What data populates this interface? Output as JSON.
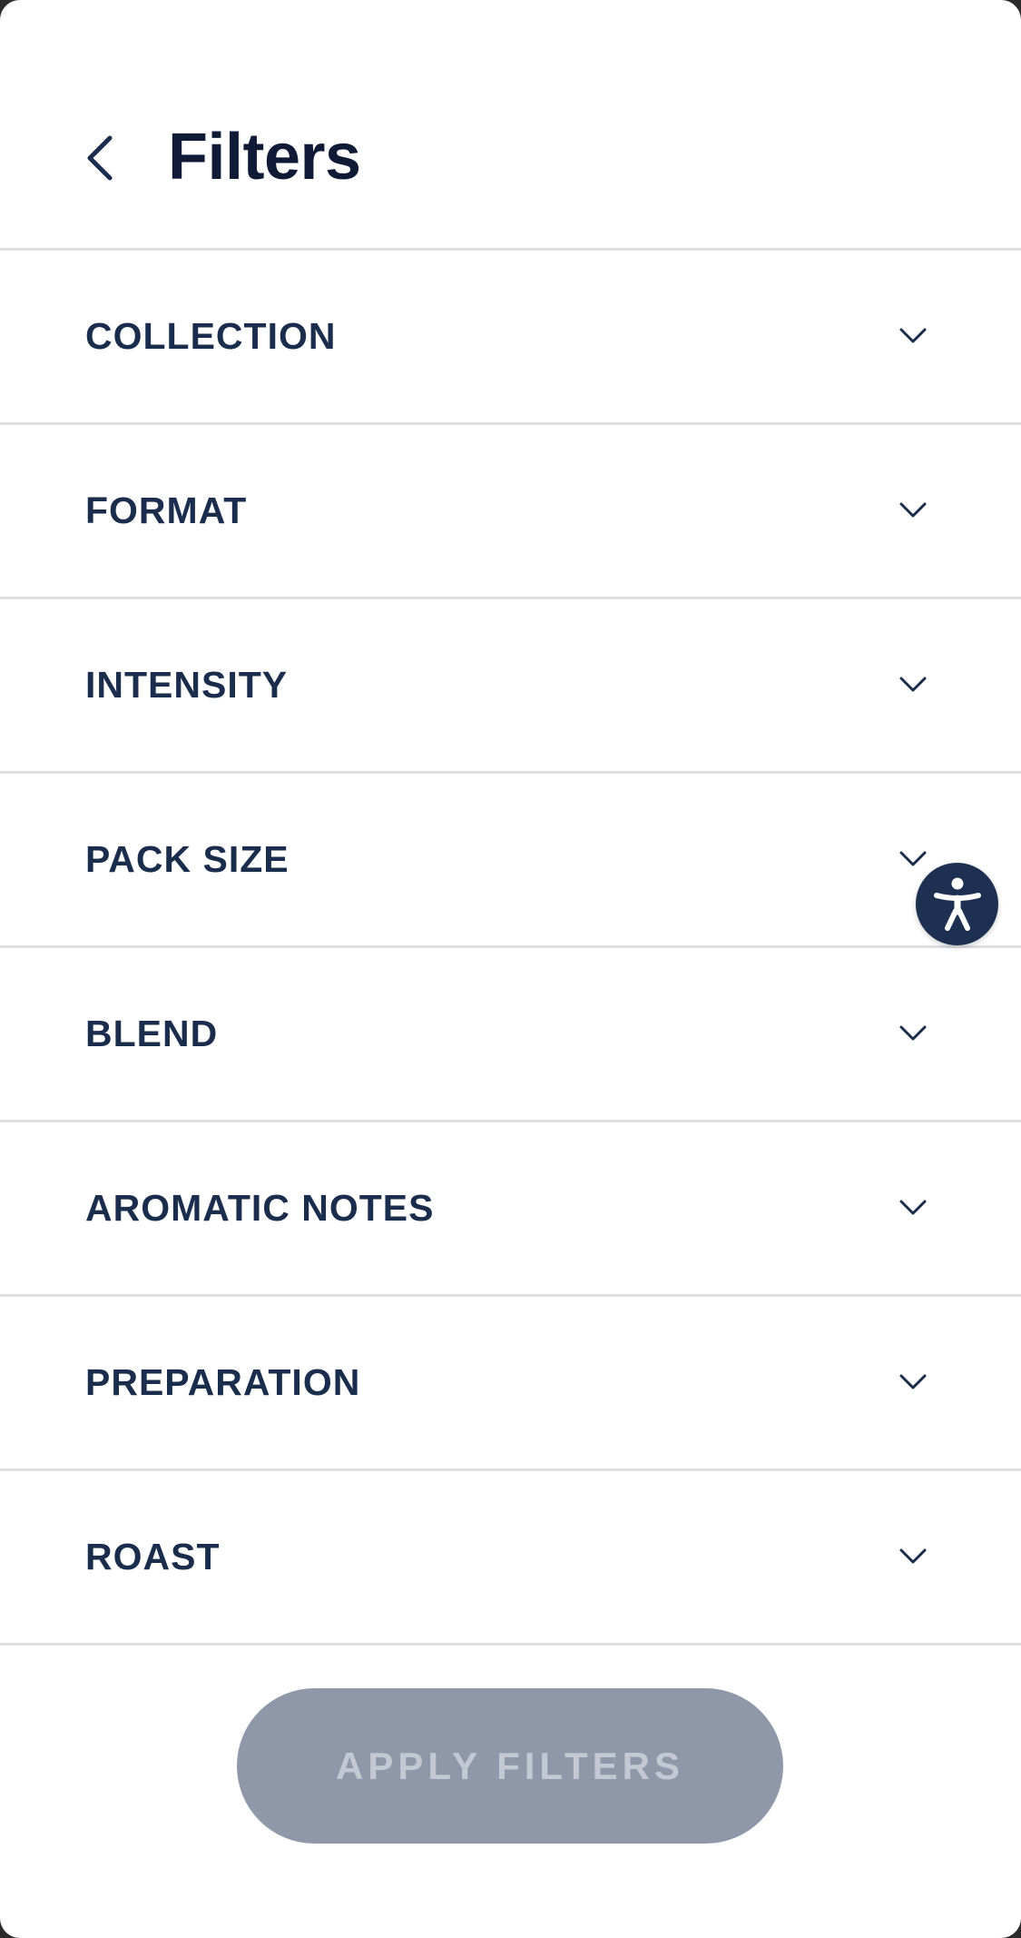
{
  "header": {
    "title": "Filters",
    "back_icon": "chevron-left-icon"
  },
  "filters": [
    {
      "label": "COLLECTION",
      "icon": "chevron-down-icon"
    },
    {
      "label": "FORMAT",
      "icon": "chevron-down-icon"
    },
    {
      "label": "INTENSITY",
      "icon": "chevron-down-icon"
    },
    {
      "label": "PACK SIZE",
      "icon": "chevron-down-icon"
    },
    {
      "label": "BLEND",
      "icon": "chevron-down-icon"
    },
    {
      "label": "AROMATIC NOTES",
      "icon": "chevron-down-icon"
    },
    {
      "label": "PREPARATION",
      "icon": "chevron-down-icon"
    },
    {
      "label": "ROAST",
      "icon": "chevron-down-icon"
    }
  ],
  "footer": {
    "apply_label": "APPLY FILTERS"
  },
  "accessibility": {
    "icon": "accessibility-icon"
  },
  "colors": {
    "title": "#0f1b36",
    "label": "#1b2d4d",
    "divider": "#dcdee2",
    "apply_button_bg": "#8e98a9",
    "apply_button_text": "#c3c9d3",
    "accessibility_bg": "#1d3052"
  }
}
